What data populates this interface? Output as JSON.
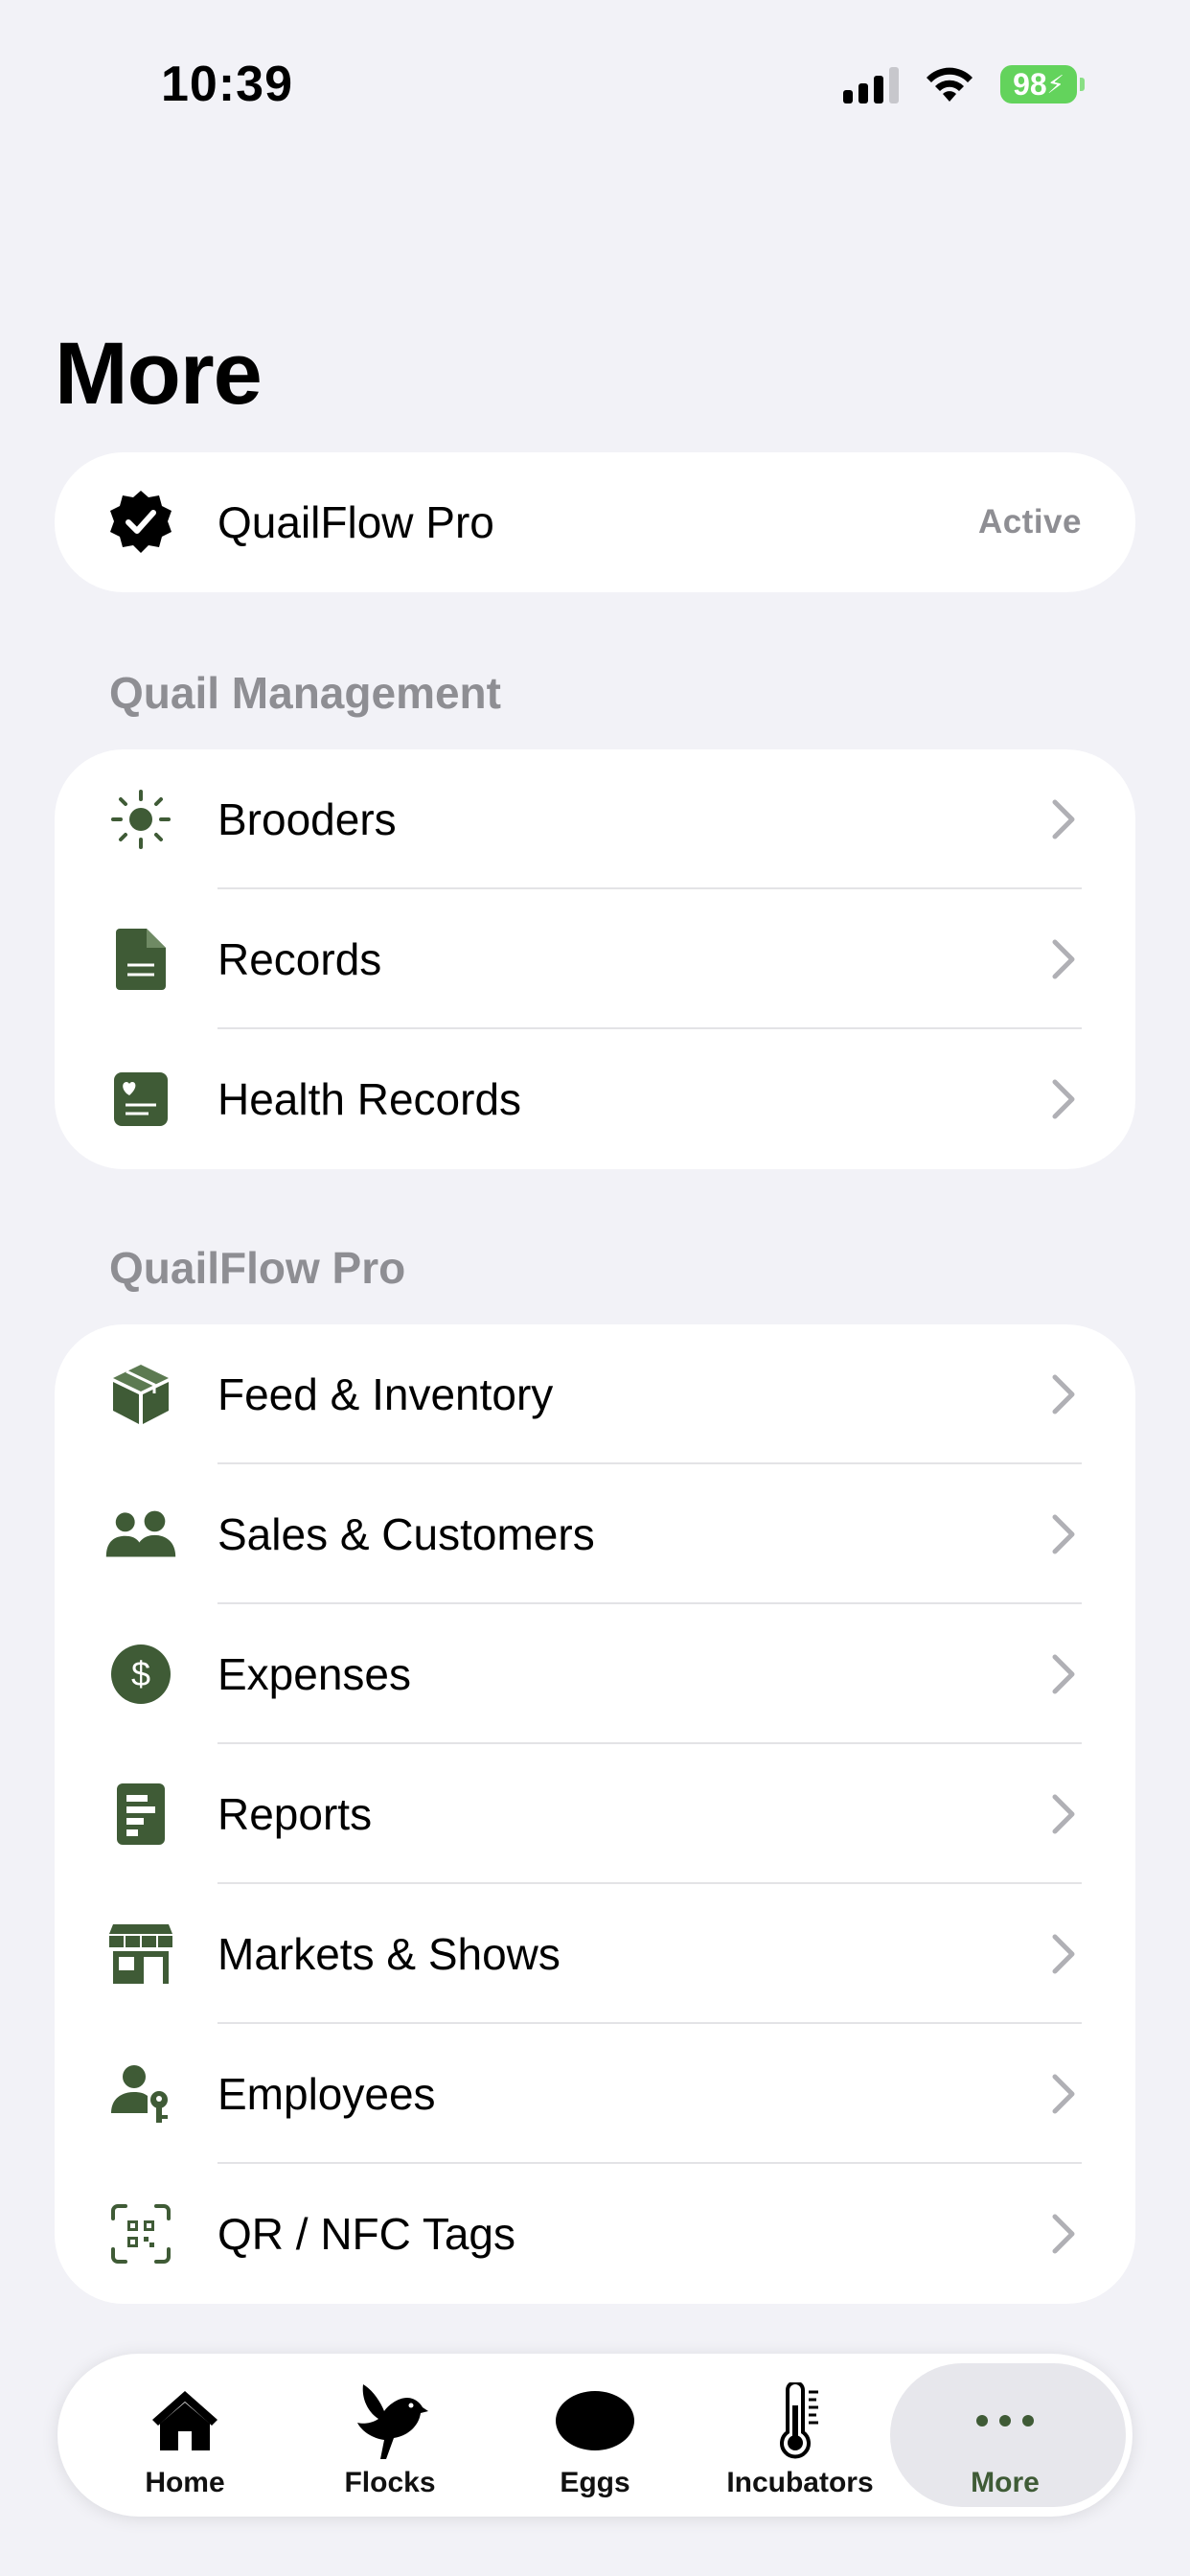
{
  "status_bar": {
    "time": "10:39",
    "battery": "98"
  },
  "page_title": "More",
  "pro_card": {
    "label": "QuailFlow Pro",
    "status": "Active"
  },
  "sections": [
    {
      "header": "Quail Management",
      "items": [
        {
          "label": "Brooders",
          "icon": "sun-icon"
        },
        {
          "label": "Records",
          "icon": "document-icon"
        },
        {
          "label": "Health Records",
          "icon": "health-record-icon"
        }
      ]
    },
    {
      "header": "QuailFlow Pro",
      "items": [
        {
          "label": "Feed & Inventory",
          "icon": "box-icon"
        },
        {
          "label": "Sales & Customers",
          "icon": "people-icon"
        },
        {
          "label": "Expenses",
          "icon": "dollar-icon"
        },
        {
          "label": "Reports",
          "icon": "report-icon"
        },
        {
          "label": "Markets & Shows",
          "icon": "storefront-icon"
        },
        {
          "label": "Employees",
          "icon": "person-key-icon"
        },
        {
          "label": "QR / NFC Tags",
          "icon": "qr-code-icon"
        }
      ]
    }
  ],
  "tab_bar": {
    "tabs": [
      {
        "label": "Home",
        "icon": "house-icon"
      },
      {
        "label": "Flocks",
        "icon": "bird-icon"
      },
      {
        "label": "Eggs",
        "icon": "egg-icon"
      },
      {
        "label": "Incubators",
        "icon": "thermometer-icon"
      },
      {
        "label": "More",
        "icon": "ellipsis-icon",
        "active": true
      }
    ]
  },
  "colors": {
    "accent": "#3F5B36",
    "background": "#F2F2F7",
    "secondary_text": "#8E8E93"
  }
}
